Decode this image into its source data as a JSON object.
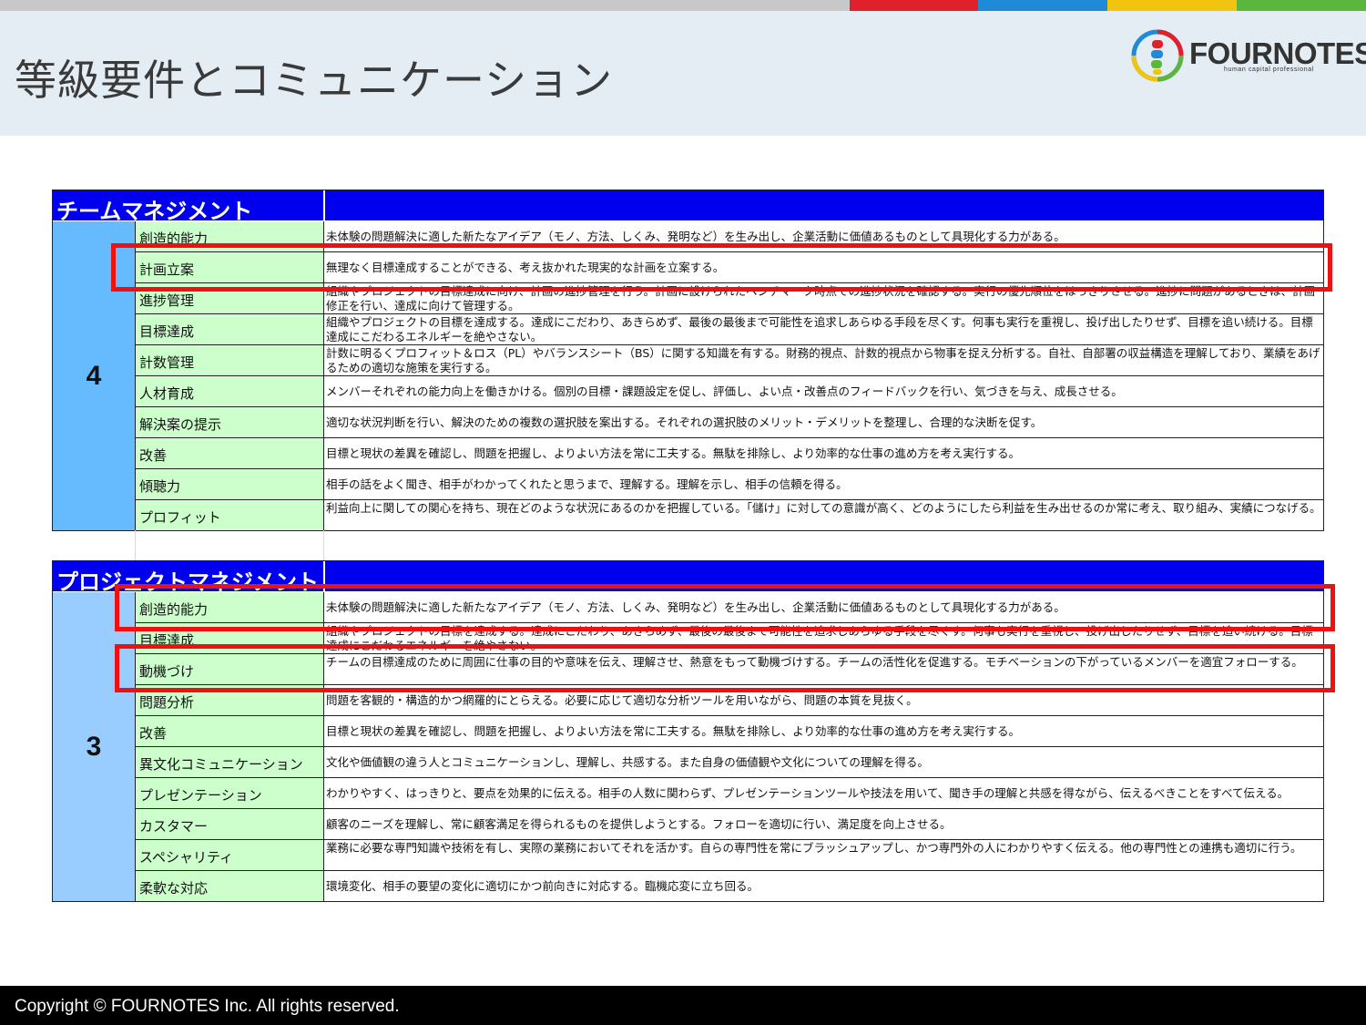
{
  "header": {
    "title": "等級要件とコミュニケーション",
    "logo_text": "FOURNOTES",
    "logo_sub": "human capital professional"
  },
  "colors": {
    "top_bar": [
      "#c8c8c8",
      "#e0202b",
      "#1f8ad6",
      "#f1c40f",
      "#5cb53d"
    ],
    "section_header": "#0000ee",
    "level4_cell": "#66bbff",
    "level3_cell": "#99ccff",
    "name_cell": "#ccffcc",
    "highlight": "#ee1111"
  },
  "sections": [
    {
      "title": "チームマネジメント",
      "level": "4",
      "rows": [
        {
          "name": "創造的能力",
          "desc": "未体験の問題解決に適した新たなアイデア（モノ、方法、しくみ、発明など）を生み出し、企業活動に価値あるものとして具現化する力がある。"
        },
        {
          "name": "計画立案",
          "desc": "無理なく目標達成することができる、考え抜かれた現実的な計画を立案する。"
        },
        {
          "name": "進捗管理",
          "desc": "組織やプロジェクトの目標達成に向け、計画の進捗管理を行う。計画に設けられたベンチマーク時点での進捗状況を確認する。実行の優先順位をはっきりさせる。進捗に問題があるときは、計画修正を行い、達成に向けて管理する。"
        },
        {
          "name": "目標達成",
          "desc": "組織やプロジェクトの目標を達成する。達成にこだわり、あきらめず、最後の最後まで可能性を追求しあらゆる手段を尽くす。何事も実行を重視し、投げ出したりせず、目標を追い続ける。目標達成にこだわるエネルギーを絶やさない。"
        },
        {
          "name": "計数管理",
          "desc": "計数に明るくプロフィット＆ロス（PL）やバランスシート（BS）に関する知識を有する。財務的視点、計数的視点から物事を捉え分析する。自社、自部署の収益構造を理解しており、業績をあげるための適切な施策を実行する。"
        },
        {
          "name": "人材育成",
          "desc": "メンバーそれぞれの能力向上を働きかける。個別の目標・課題設定を促し、評価し、よい点・改善点のフィードバックを行い、気づきを与え、成長させる。"
        },
        {
          "name": "解決案の提示",
          "desc": "適切な状況判断を行い、解決のための複数の選択肢を案出する。それぞれの選択肢のメリット・デメリットを整理し、合理的な決断を促す。"
        },
        {
          "name": "改善",
          "desc": "目標と現状の差異を確認し、問題を把握し、よりよい方法を常に工夫する。無駄を排除し、より効率的な仕事の進め方を考え実行する。"
        },
        {
          "name": "傾聴力",
          "desc": "相手の話をよく聞き、相手がわかってくれたと思うまで、理解する。理解を示し、相手の信頼を得る。"
        },
        {
          "name": "プロフィット",
          "desc": "利益向上に関しての関心を持ち、現在どのような状況にあるのかを把握している。「儲け」に対しての意識が高く、どのようにしたら利益を生み出せるのか常に考え、取り組み、実績につなげる。"
        }
      ]
    },
    {
      "title": "プロジェクトマネジメント",
      "level": "3",
      "rows": [
        {
          "name": "創造的能力",
          "desc": "未体験の問題解決に適した新たなアイデア（モノ、方法、しくみ、発明など）を生み出し、企業活動に価値あるものとして具現化する力がある。"
        },
        {
          "name": "目標達成",
          "desc": "組織やプロジェクトの目標を達成する。達成にこだわり、あきらめず、最後の最後まで可能性を追求しあらゆる手段を尽くす。何事も実行を重視し、投げ出したりせず、目標を追い続ける。目標達成にこだわるエネルギーを絶やさない。"
        },
        {
          "name": "動機づけ",
          "desc": "チームの目標達成のために周囲に仕事の目的や意味を伝え、理解させ、熱意をもって動機づけする。チームの活性化を促進する。モチベーションの下がっているメンバーを適宜フォローする。"
        },
        {
          "name": "問題分析",
          "desc": "問題を客観的・構造的かつ網羅的にとらえる。必要に応じて適切な分析ツールを用いながら、問題の本質を見抜く。"
        },
        {
          "name": "改善",
          "desc": "目標と現状の差異を確認し、問題を把握し、よりよい方法を常に工夫する。無駄を排除し、より効率的な仕事の進め方を考え実行する。"
        },
        {
          "name": "異文化コミュニケーション",
          "desc": "文化や価値観の違う人とコミュニケーションし、理解し、共感する。また自身の価値観や文化についての理解を得る。"
        },
        {
          "name": "プレゼンテーション",
          "desc": "わかりやすく、はっきりと、要点を効果的に伝える。相手の人数に関わらず、プレゼンテーションツールや技法を用いて、聞き手の理解と共感を得ながら、伝えるべきことをすべて伝える。"
        },
        {
          "name": "カスタマー",
          "desc": "顧客のニーズを理解し、常に顧客満足を得られるものを提供しようとする。フォローを適切に行い、満足度を向上させる。"
        },
        {
          "name": "スペシャリティ",
          "desc": "業務に必要な専門知識や技術を有し、実際の業務においてそれを活かす。自らの専門性を常にブラッシュアップし、かつ専門外の人にわかりやすく伝える。他の専門性との連携も適切に行う。"
        },
        {
          "name": "柔軟な対応",
          "desc": "環境変化、相手の要望の変化に適切にかつ前向きに対応する。臨機応変に立ち回る。"
        }
      ]
    }
  ],
  "footer": {
    "copyright": "Copyright © FOURNOTES Inc. All rights reserved."
  }
}
